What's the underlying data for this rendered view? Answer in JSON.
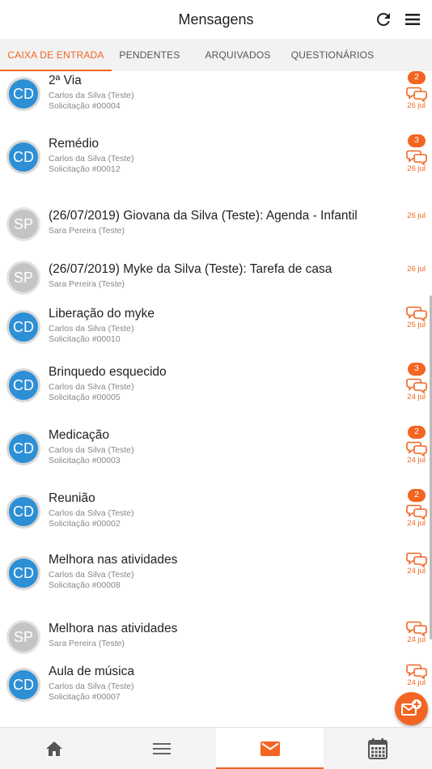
{
  "header": {
    "title": "Mensagens",
    "refresh_icon": "refresh-icon",
    "menu_icon": "hamburger-menu-icon"
  },
  "tabs": [
    {
      "label": "CAIXA DE ENTRADA",
      "active": true
    },
    {
      "label": "PENDENTES",
      "active": false
    },
    {
      "label": "ARQUIVADOS",
      "active": false
    },
    {
      "label": "QUESTIONÁRIOS",
      "active": false
    }
  ],
  "messages": [
    {
      "initials": "CD",
      "subject": "2ª Via",
      "sender": "Carlos da Silva (Teste)",
      "request": "Solicitação #00004",
      "badge": "2",
      "date": "26 jul"
    },
    {
      "initials": "CD",
      "subject": "Remédio",
      "sender": "Carlos da Silva (Teste)",
      "request": "Solicitação #00012",
      "badge": "3",
      "date": "26 jul"
    },
    {
      "initials": "SP",
      "subject": "(26/07/2019) Giovana da Silva (Teste): Agenda - Infantil",
      "sender": "Sara Pereira (Teste)",
      "request": "",
      "badge": "",
      "date": "26 jul"
    },
    {
      "initials": "SP",
      "subject": "(26/07/2019) Myke da Silva (Teste): Tarefa de casa",
      "sender": "Sara Pereira (Teste)",
      "request": "",
      "badge": "",
      "date": "26 jul"
    },
    {
      "initials": "CD",
      "subject": "Liberação do myke",
      "sender": "Carlos da Silva (Teste)",
      "request": "Solicitação #00010",
      "badge": "",
      "date": "25 jul"
    },
    {
      "initials": "CD",
      "subject": "Brinquedo esquecido",
      "sender": "Carlos da Silva (Teste)",
      "request": "Solicitação #00005",
      "badge": "3",
      "date": "24 jul"
    },
    {
      "initials": "CD",
      "subject": "Medicação",
      "sender": "Carlos da Silva (Teste)",
      "request": "Solicitação #00003",
      "badge": "2",
      "date": "24 jul"
    },
    {
      "initials": "CD",
      "subject": "Reunião",
      "sender": "Carlos da Silva (Teste)",
      "request": "Solicitação #00002",
      "badge": "2",
      "date": "24 jul"
    },
    {
      "initials": "CD",
      "subject": "Melhora nas atividades",
      "sender": "Carlos da Silva (Teste)",
      "request": "Solicitação #00008",
      "badge": "",
      "date": "24 jul"
    },
    {
      "initials": "SP",
      "subject": "Melhora nas atividades",
      "sender": "Sara Pereira (Teste)",
      "request": "",
      "badge": "",
      "date": "24 jul"
    },
    {
      "initials": "CD",
      "subject": "Aula de música",
      "sender": "Carlos da Silva (Teste)",
      "request": "Solicitação #00007",
      "badge": "",
      "date": "24 jul"
    }
  ],
  "fab": {
    "icon": "new-message-icon"
  },
  "bottom_nav": [
    {
      "icon": "home-icon",
      "active": false
    },
    {
      "icon": "list-menu-icon",
      "active": false
    },
    {
      "icon": "mail-icon",
      "active": true
    },
    {
      "icon": "calendar-icon",
      "active": false
    }
  ],
  "colors": {
    "accent": "#f26522",
    "avatar_cd": "#2d8fd5",
    "avatar_sp": "#c4c4c4"
  }
}
